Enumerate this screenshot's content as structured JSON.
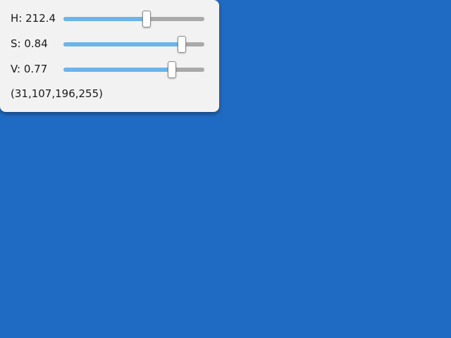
{
  "panel": {
    "sliders": [
      {
        "id": "h",
        "label": "H: 212.4",
        "fraction": 0.59
      },
      {
        "id": "s",
        "label": "S: 0.84",
        "fraction": 0.84
      },
      {
        "id": "v",
        "label": "V: 0.77",
        "fraction": 0.77
      }
    ],
    "rgba_text": "(31,107,196,255)"
  },
  "colors": {
    "background": "#1f6bc4",
    "panel": "#f2f2f2",
    "slider_fill": "#6cb4ea",
    "slider_track": "#a9a9a9"
  }
}
